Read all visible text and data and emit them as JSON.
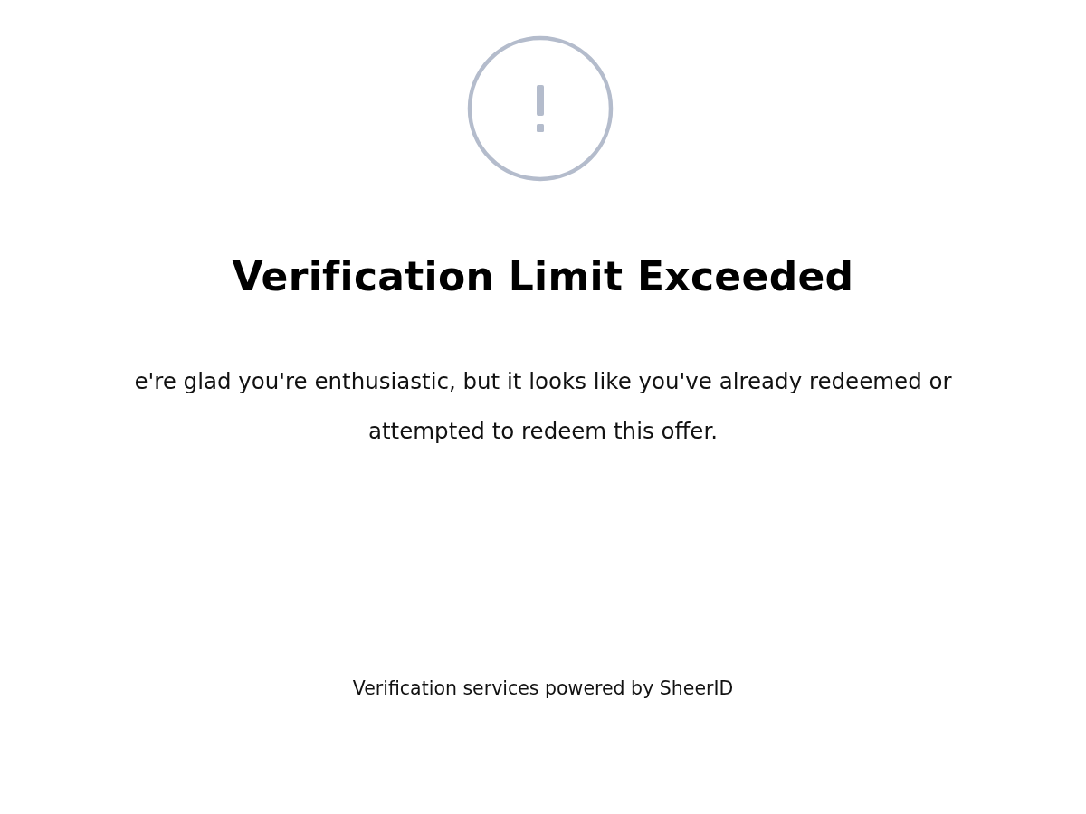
{
  "title": "Verification Limit Exceeded",
  "message": "e're glad you're enthusiastic, but it looks like you've already redeemed or\nattempted to redeem this offer.",
  "footer": "Verification services powered by SheerID"
}
